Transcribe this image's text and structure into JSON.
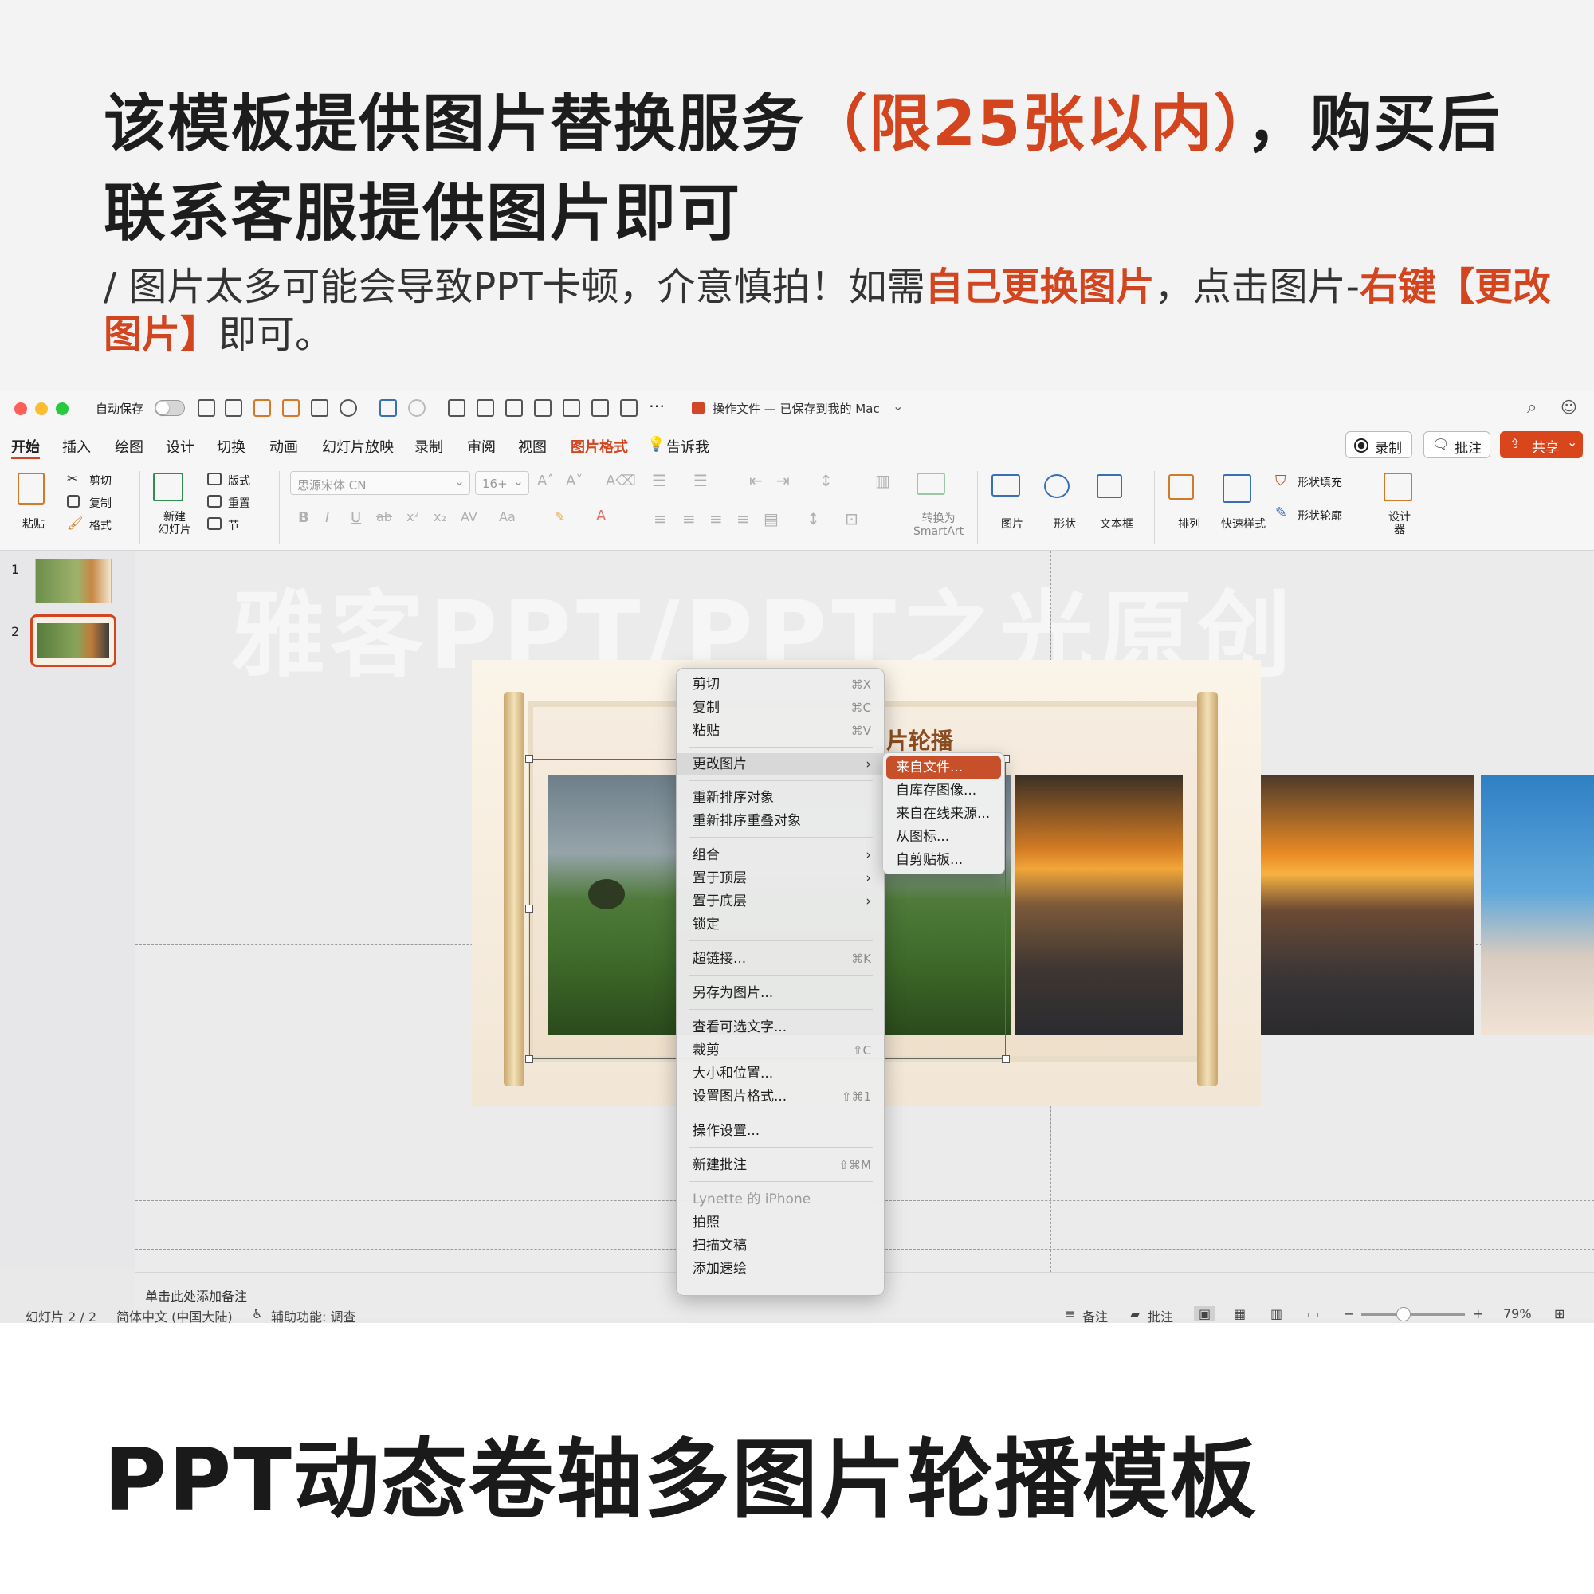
{
  "headline": {
    "part1": "该模板提供图片替换服务",
    "highlight": "（限25张以内）",
    "part2": "，购买后联系客服提供图片即可"
  },
  "subline": {
    "part1": "/ 图片太多可能会导致PPT卡顿，介意慎拍！如需",
    "highlight1": "自己更换图片",
    "part2": "，点击图片-",
    "highlight2": "右键【更改图片】",
    "part3": "即可。"
  },
  "footer_title": "PPT动态卷轴多图片轮播模板",
  "app": {
    "autosave_label": "自动保存",
    "doc_title": "操作文件 — 已保存到我的 Mac",
    "tabs": [
      "开始",
      "插入",
      "绘图",
      "设计",
      "切换",
      "动画",
      "幻灯片放映",
      "录制",
      "审阅",
      "视图",
      "图片格式",
      "告诉我"
    ],
    "active_tab": "开始",
    "context_tab": "图片格式",
    "buttons": {
      "record": "录制",
      "comment": "批注",
      "share": "共享"
    },
    "ribbon": {
      "paste": "粘贴",
      "cut": "剪切",
      "copy": "复制",
      "format": "格式",
      "new_slide": "新建\n幻灯片",
      "layout": "版式",
      "reset": "重置",
      "section": "节",
      "font_name": "思源宋体 CN",
      "font_size": "16+",
      "convert_smartart": "转换为\nSmartArt",
      "picture": "图片",
      "shape": "形状",
      "textbox": "文本框",
      "arrange": "排列",
      "quick_styles": "快速样式",
      "shape_fill": "形状填充",
      "shape_outline": "形状轮廓",
      "designer": "设计\n器"
    },
    "slides": [
      {
        "number": "1"
      },
      {
        "number": "2",
        "selected": true
      }
    ],
    "watermark": "雅客PPT/PPT之光原创",
    "slide_title_fragment": "片轮播",
    "notes_placeholder": "单击此处添加备注",
    "status": {
      "slide": "幻灯片 2 / 2",
      "language": "简体中文 (中国大陆)",
      "accessibility": "辅助功能: 调查",
      "notes": "备注",
      "comments": "批注",
      "zoom": "79%"
    },
    "context_menu": {
      "items": [
        {
          "label": "剪切",
          "shortcut": "⌘X"
        },
        {
          "label": "复制",
          "shortcut": "⌘C"
        },
        {
          "label": "粘贴",
          "shortcut": "⌘V"
        },
        {
          "label": "更改图片",
          "submenu": true
        },
        {
          "label": "重新排序对象"
        },
        {
          "label": "重新排序重叠对象"
        },
        {
          "label": "组合",
          "submenu": true
        },
        {
          "label": "置于顶层",
          "submenu": true
        },
        {
          "label": "置于底层",
          "submenu": true
        },
        {
          "label": "锁定"
        },
        {
          "label": "超链接...",
          "shortcut": "⌘K"
        },
        {
          "label": "另存为图片..."
        },
        {
          "label": "查看可选文字..."
        },
        {
          "label": "裁剪",
          "shortcut": "⇧C"
        },
        {
          "label": "大小和位置..."
        },
        {
          "label": "设置图片格式...",
          "shortcut": "⇧⌘1"
        },
        {
          "label": "操作设置..."
        },
        {
          "label": "新建批注",
          "shortcut": "⇧⌘M"
        },
        {
          "label": "Lynette 的 iPhone",
          "disabled": true
        },
        {
          "label": "拍照"
        },
        {
          "label": "扫描文稿"
        },
        {
          "label": "添加速绘"
        }
      ],
      "submenu": [
        "来自文件...",
        "自库存图像...",
        "来自在线来源...",
        "从图标...",
        "自剪贴板..."
      ]
    }
  },
  "colors": {
    "accent": "#d2451e",
    "share": "#d9461c",
    "active_menu": "#c7502a"
  }
}
